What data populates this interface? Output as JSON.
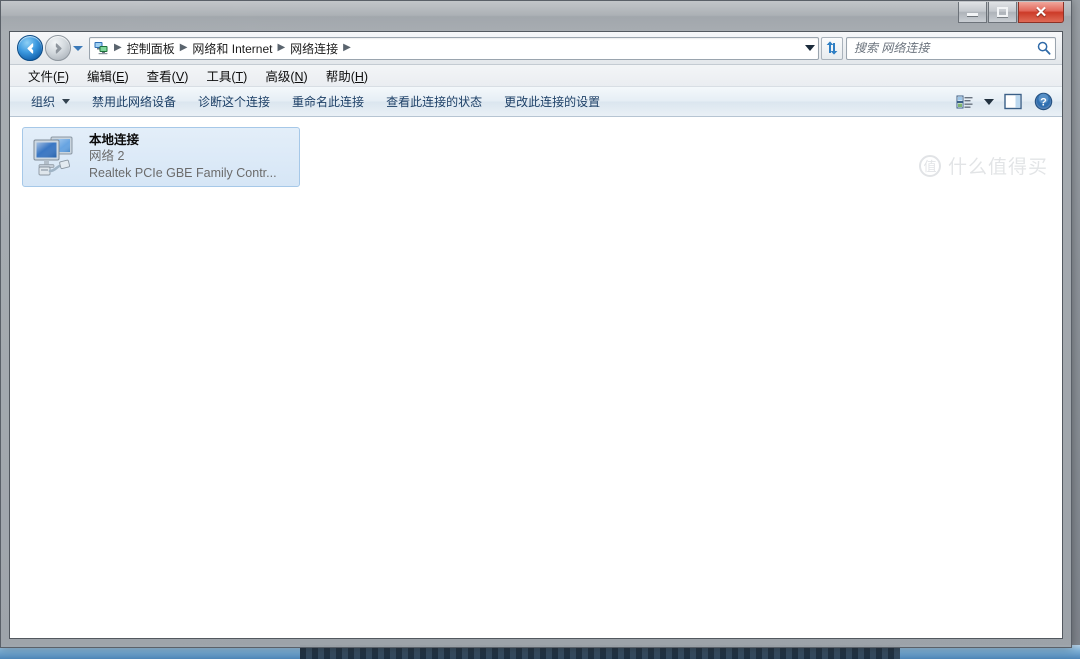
{
  "window": {
    "title": "",
    "controls": {
      "minimize_label": "最小化",
      "maximize_label": "最大化",
      "close_label": "✕"
    }
  },
  "navbar": {
    "back_label": "后退",
    "forward_label": "前进",
    "recent_pages_label": "最近浏览的页面",
    "breadcrumb_icon": "network-connections-icon",
    "breadcrumbs": [
      {
        "label": "控制面板"
      },
      {
        "label": "网络和 Internet"
      },
      {
        "label": "网络连接"
      }
    ],
    "separator": "▶",
    "address_dropdown_label": "地址下拉",
    "refresh_label": "刷新",
    "refresh_icon": "refresh-icon"
  },
  "search": {
    "value": "",
    "placeholder": "搜索 网络连接",
    "icon": "search-icon"
  },
  "menubar": {
    "items": [
      {
        "prefix": "文件(",
        "key": "F",
        "suffix": ")"
      },
      {
        "prefix": "编辑(",
        "key": "E",
        "suffix": ")"
      },
      {
        "prefix": "查看(",
        "key": "V",
        "suffix": ")"
      },
      {
        "prefix": "工具(",
        "key": "T",
        "suffix": ")"
      },
      {
        "prefix": "高级(",
        "key": "N",
        "suffix": ")"
      },
      {
        "prefix": "帮助(",
        "key": "H",
        "suffix": ")"
      }
    ]
  },
  "toolbar": {
    "organize_label": "组织",
    "commands": [
      {
        "label": "禁用此网络设备"
      },
      {
        "label": "诊断这个连接"
      },
      {
        "label": "重命名此连接"
      },
      {
        "label": "查看此连接的状态"
      },
      {
        "label": "更改此连接的设置"
      }
    ],
    "view_label": "更改您的视图",
    "view_icon": "view-layout-icon",
    "view_dropdown_label": "视图下拉",
    "preview_pane_label": "显示预览窗格",
    "preview_pane_icon": "preview-pane-icon",
    "help_label": "获取帮助",
    "help_icon": "help-icon"
  },
  "content": {
    "connections": [
      {
        "name": "本地连接",
        "network": "网络  2",
        "device": "Realtek PCIe GBE Family Contr...",
        "icon": "lan-connection-icon",
        "selected": true
      }
    ]
  },
  "watermark": {
    "logo_char": "值",
    "text": "什么值得买"
  },
  "colors": {
    "accent_blue": "#1c3f66",
    "selection_bg": "#d6e6f6",
    "selection_border": "#a6c8e8",
    "close_red": "#cc3a28",
    "frame_gray": "#52585f"
  }
}
